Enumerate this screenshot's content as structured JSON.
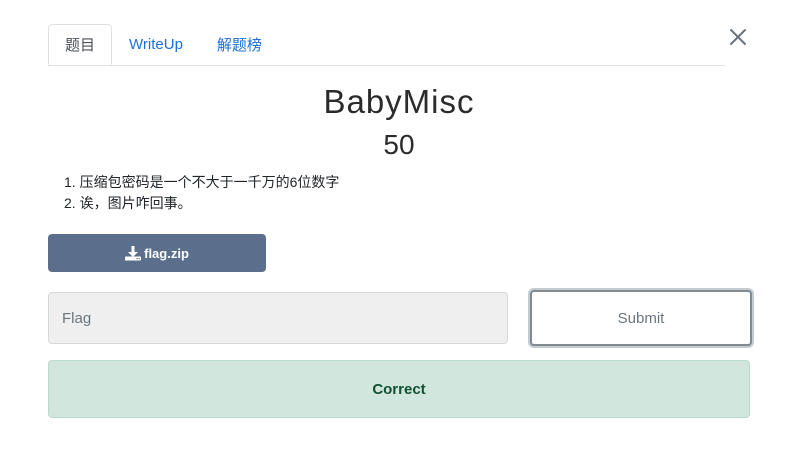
{
  "tabs": [
    {
      "label": "题目",
      "active": true
    },
    {
      "label": "WriteUp",
      "active": false
    },
    {
      "label": "解题榜",
      "active": false
    }
  ],
  "challenge": {
    "title": "BabyMisc",
    "points": "50",
    "description": [
      "1. 压缩包密码是一个不大于一千万的6位数字",
      "2. 诶，图片咋回事。"
    ]
  },
  "download": {
    "label": "flag.zip",
    "icon": "download-icon"
  },
  "flag_form": {
    "placeholder": "Flag",
    "value": "",
    "submit_label": "Submit"
  },
  "result": {
    "message": "Correct",
    "status": "success"
  },
  "colors": {
    "link": "#1a6fd6",
    "download_button": "#5b6f8c",
    "success_bg": "#d1e7dd",
    "success_text": "#0f5132"
  }
}
